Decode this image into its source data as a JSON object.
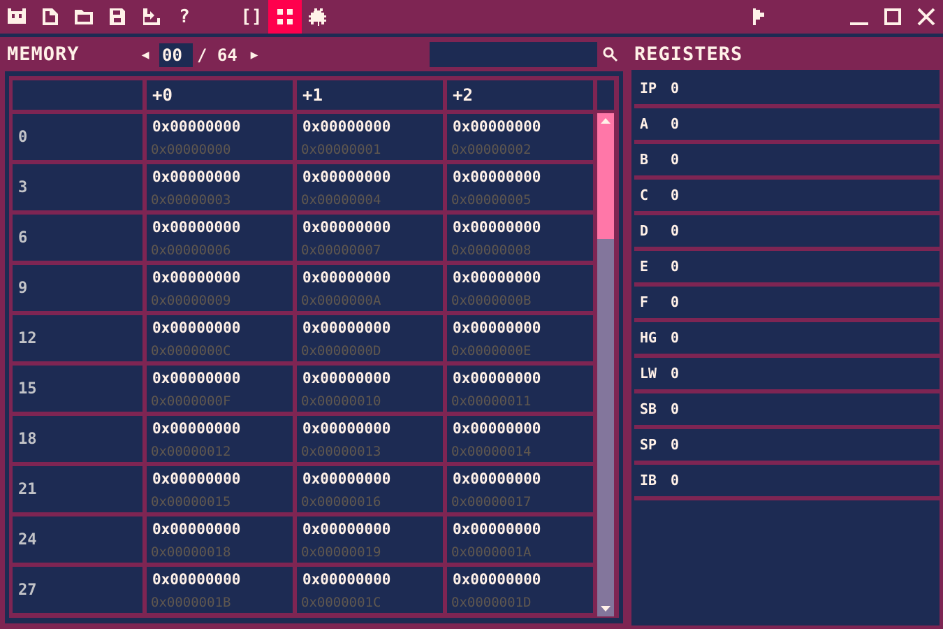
{
  "toolbar": {
    "left_icons": [
      "cart-icon",
      "new-file-icon",
      "open-folder-icon",
      "save-icon",
      "export-icon",
      "help-icon"
    ],
    "code_brackets": "[]",
    "active_icon": "memory-grid-icon",
    "debug_icon": "bug-icon",
    "right_icons": [
      "run-icon",
      "minimize-icon",
      "maximize-icon",
      "close-icon"
    ]
  },
  "memory": {
    "title": "MEMORY",
    "page_current": "00",
    "page_total": "/ 64",
    "search_value": "",
    "columns": [
      "",
      "+0",
      "+1",
      "+2"
    ],
    "rows": [
      {
        "addr": "0",
        "cells": [
          {
            "v": "0x00000000",
            "a": "0x00000000"
          },
          {
            "v": "0x00000000",
            "a": "0x00000001"
          },
          {
            "v": "0x00000000",
            "a": "0x00000002"
          }
        ]
      },
      {
        "addr": "3",
        "cells": [
          {
            "v": "0x00000000",
            "a": "0x00000003"
          },
          {
            "v": "0x00000000",
            "a": "0x00000004"
          },
          {
            "v": "0x00000000",
            "a": "0x00000005"
          }
        ]
      },
      {
        "addr": "6",
        "cells": [
          {
            "v": "0x00000000",
            "a": "0x00000006"
          },
          {
            "v": "0x00000000",
            "a": "0x00000007"
          },
          {
            "v": "0x00000000",
            "a": "0x00000008"
          }
        ]
      },
      {
        "addr": "9",
        "cells": [
          {
            "v": "0x00000000",
            "a": "0x00000009"
          },
          {
            "v": "0x00000000",
            "a": "0x0000000A"
          },
          {
            "v": "0x00000000",
            "a": "0x0000000B"
          }
        ]
      },
      {
        "addr": "12",
        "cells": [
          {
            "v": "0x00000000",
            "a": "0x0000000C"
          },
          {
            "v": "0x00000000",
            "a": "0x0000000D"
          },
          {
            "v": "0x00000000",
            "a": "0x0000000E"
          }
        ]
      },
      {
        "addr": "15",
        "cells": [
          {
            "v": "0x00000000",
            "a": "0x0000000F"
          },
          {
            "v": "0x00000000",
            "a": "0x00000010"
          },
          {
            "v": "0x00000000",
            "a": "0x00000011"
          }
        ]
      },
      {
        "addr": "18",
        "cells": [
          {
            "v": "0x00000000",
            "a": "0x00000012"
          },
          {
            "v": "0x00000000",
            "a": "0x00000013"
          },
          {
            "v": "0x00000000",
            "a": "0x00000014"
          }
        ]
      },
      {
        "addr": "21",
        "cells": [
          {
            "v": "0x00000000",
            "a": "0x00000015"
          },
          {
            "v": "0x00000000",
            "a": "0x00000016"
          },
          {
            "v": "0x00000000",
            "a": "0x00000017"
          }
        ]
      },
      {
        "addr": "24",
        "cells": [
          {
            "v": "0x00000000",
            "a": "0x00000018"
          },
          {
            "v": "0x00000000",
            "a": "0x00000019"
          },
          {
            "v": "0x00000000",
            "a": "0x0000001A"
          }
        ]
      },
      {
        "addr": "27",
        "cells": [
          {
            "v": "0x00000000",
            "a": "0x0000001B"
          },
          {
            "v": "0x00000000",
            "a": "0x0000001C"
          },
          {
            "v": "0x00000000",
            "a": "0x0000001D"
          }
        ]
      }
    ],
    "scroll_fraction": 0.22
  },
  "registers": {
    "title": "REGISTERS",
    "items": [
      {
        "name": "IP",
        "value": "0"
      },
      {
        "name": "A",
        "value": "0"
      },
      {
        "name": "B",
        "value": "0"
      },
      {
        "name": "C",
        "value": "0"
      },
      {
        "name": "D",
        "value": "0"
      },
      {
        "name": "E",
        "value": "0"
      },
      {
        "name": "F",
        "value": "0"
      },
      {
        "name": "HG",
        "value": "0"
      },
      {
        "name": "LW",
        "value": "0"
      },
      {
        "name": "SB",
        "value": "0"
      },
      {
        "name": "SP",
        "value": "0"
      },
      {
        "name": "IB",
        "value": "0"
      }
    ]
  },
  "colors": {
    "frame": "#7e2553",
    "panel": "#1d2b53",
    "accent": "#ff004d",
    "scroll_thumb": "#ff77a8",
    "scroll_track": "#83769c",
    "text": "#fff1e8",
    "dim_text": "#5f574f"
  }
}
